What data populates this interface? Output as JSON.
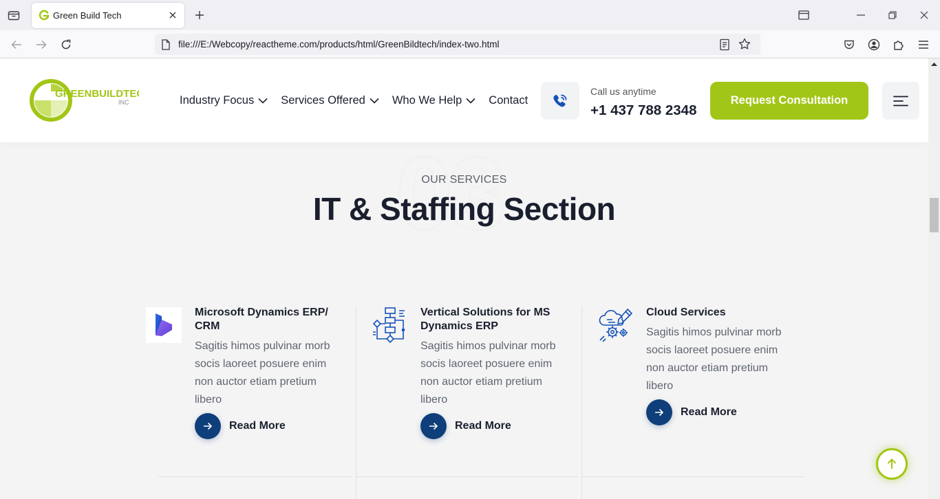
{
  "browser": {
    "tab_title": "Green Build Tech",
    "url": "file:///E:/Webcopy/reactheme.com/products/html/GreenBildtech/index-two.html"
  },
  "header": {
    "logo_text": "GREENBUILDTECH",
    "logo_sub": "INC",
    "nav": [
      {
        "label": "Industry Focus",
        "has_dropdown": true
      },
      {
        "label": "Services Offered",
        "has_dropdown": true
      },
      {
        "label": "Who We Help",
        "has_dropdown": true
      },
      {
        "label": "Contact",
        "has_dropdown": false
      }
    ],
    "call_label": "Call us anytime",
    "call_number": "+1 437 788 2348",
    "cta_label": "Request Consultation"
  },
  "section": {
    "watermark": "03",
    "subtitle": "OUR SERVICES",
    "title": "IT & Staffing Section"
  },
  "services": [
    {
      "title": "Microsoft Dynamics ERP/ CRM",
      "desc": "Sagitis himos pulvinar morb socis laoreet posuere enim non auctor etiam pretium libero",
      "link": "Read More",
      "icon": "dynamics-logo-icon"
    },
    {
      "title": "Vertical Solutions for MS Dynamics ERP",
      "desc": "Sagitis himos pulvinar morb socis laoreet posuere enim non auctor etiam pretium libero",
      "link": "Read More",
      "icon": "flowchart-icon"
    },
    {
      "title": "Cloud Services",
      "desc": "Sagitis himos pulvinar morb socis laoreet posuere enim non auctor etiam pretium libero",
      "link": "Read More",
      "icon": "cloud-gear-icon"
    }
  ],
  "colors": {
    "brand_green": "#a2c617",
    "navy": "#0f3f7a",
    "heading": "#1a1f2e"
  }
}
